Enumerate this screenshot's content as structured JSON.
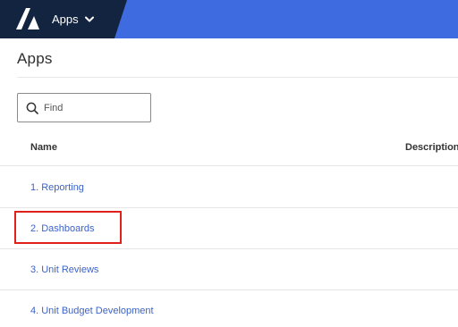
{
  "header": {
    "menu_label": "Apps",
    "colors": {
      "bar": "#3f6be0",
      "dark": "#12243f"
    }
  },
  "page": {
    "title": "Apps"
  },
  "search": {
    "placeholder": "Find",
    "value": ""
  },
  "table": {
    "columns": {
      "name": "Name",
      "description": "Description"
    },
    "rows": [
      {
        "name": "1. Reporting"
      },
      {
        "name": "2. Dashboards",
        "highlighted": true
      },
      {
        "name": "3. Unit Reviews"
      },
      {
        "name": "4. Unit Budget Development"
      }
    ]
  },
  "icons": [
    "app-logo-icon",
    "chevron-down-icon",
    "search-icon"
  ],
  "colors": {
    "link": "#3a63c9",
    "highlight": "#e0201b"
  }
}
